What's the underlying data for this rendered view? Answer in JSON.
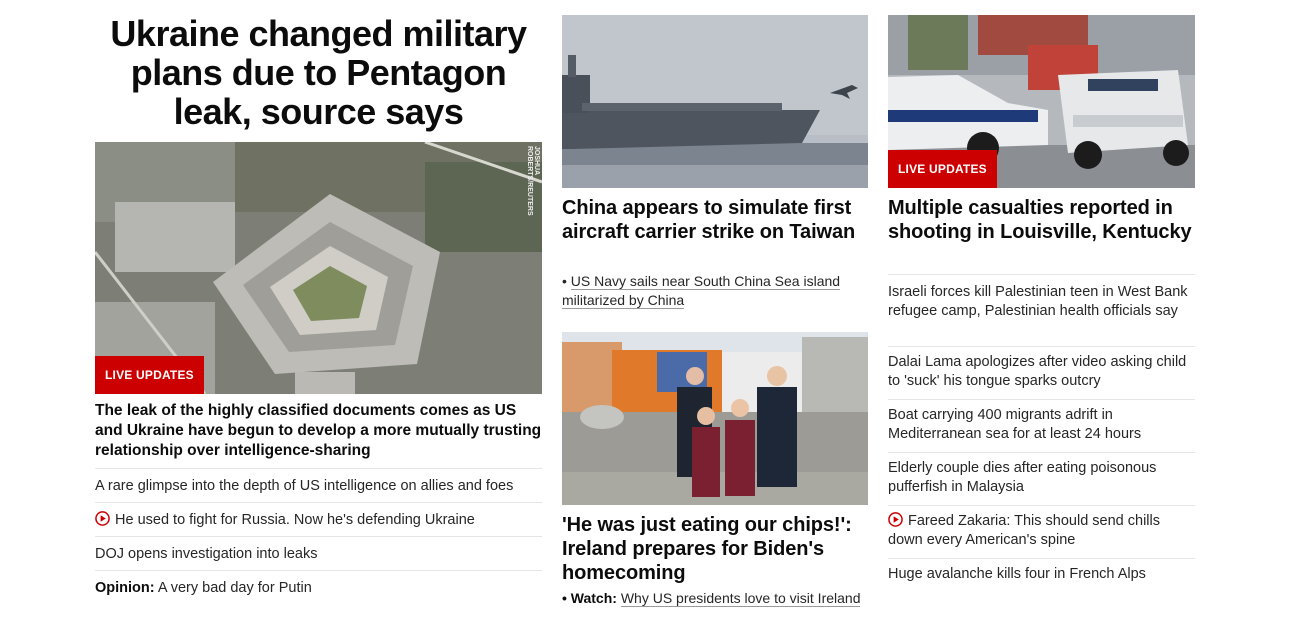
{
  "lead": {
    "headline": "Ukraine changed military plans due to Pentagon leak, source says",
    "image_credit": "JOSHUA ROBERTS/REUTERS",
    "badge": "LIVE UPDATES",
    "summary": "The leak of the highly classified documents comes as US and Ukraine have begun to develop a more mutually trusting relationship over intelligence-sharing",
    "related": [
      {
        "text": "A rare glimpse into the depth of US intelligence on allies and foes"
      },
      {
        "text": "He used to fight for Russia. Now he's defending Ukraine",
        "icon": "play-icon"
      },
      {
        "text": "DOJ opens investigation into leaks"
      },
      {
        "prefix": "Opinion:",
        "text": "A very bad day for Putin"
      }
    ]
  },
  "middle": {
    "story1": {
      "headline": "China appears to simulate first aircraft carrier strike on Taiwan",
      "sub_bullet": "•",
      "sub_text": "US Navy sails near South China Sea island militarized by China"
    },
    "story2": {
      "headline": "'He was just eating our chips!': Ireland prepares for Biden's homecoming",
      "sub_prefix": "• Watch:",
      "sub_text": "Why US presidents love to visit Ireland"
    }
  },
  "right": {
    "badge": "LIVE UPDATES",
    "headline": "Multiple casualties reported in shooting in Louisville, Kentucky",
    "items": [
      {
        "text": "Israeli forces kill Palestinian teen in West Bank refugee camp, Palestinian health officials say"
      },
      {
        "text": "Dalai Lama apologizes after video asking child to 'suck' his tongue sparks outcry"
      },
      {
        "text": "Boat carrying 400 migrants adrift in Mediterranean sea for at least 24 hours"
      },
      {
        "text": "Elderly couple dies after eating poisonous pufferfish in Malaysia"
      },
      {
        "text": "Fareed Zakaria: This should send chills down every American's spine",
        "icon": "play-icon"
      },
      {
        "text": "Huge avalanche kills four in French Alps"
      }
    ]
  },
  "colors": {
    "accent": "#cc0000",
    "text": "#0c0c0c",
    "divider": "#e6e6e6"
  }
}
